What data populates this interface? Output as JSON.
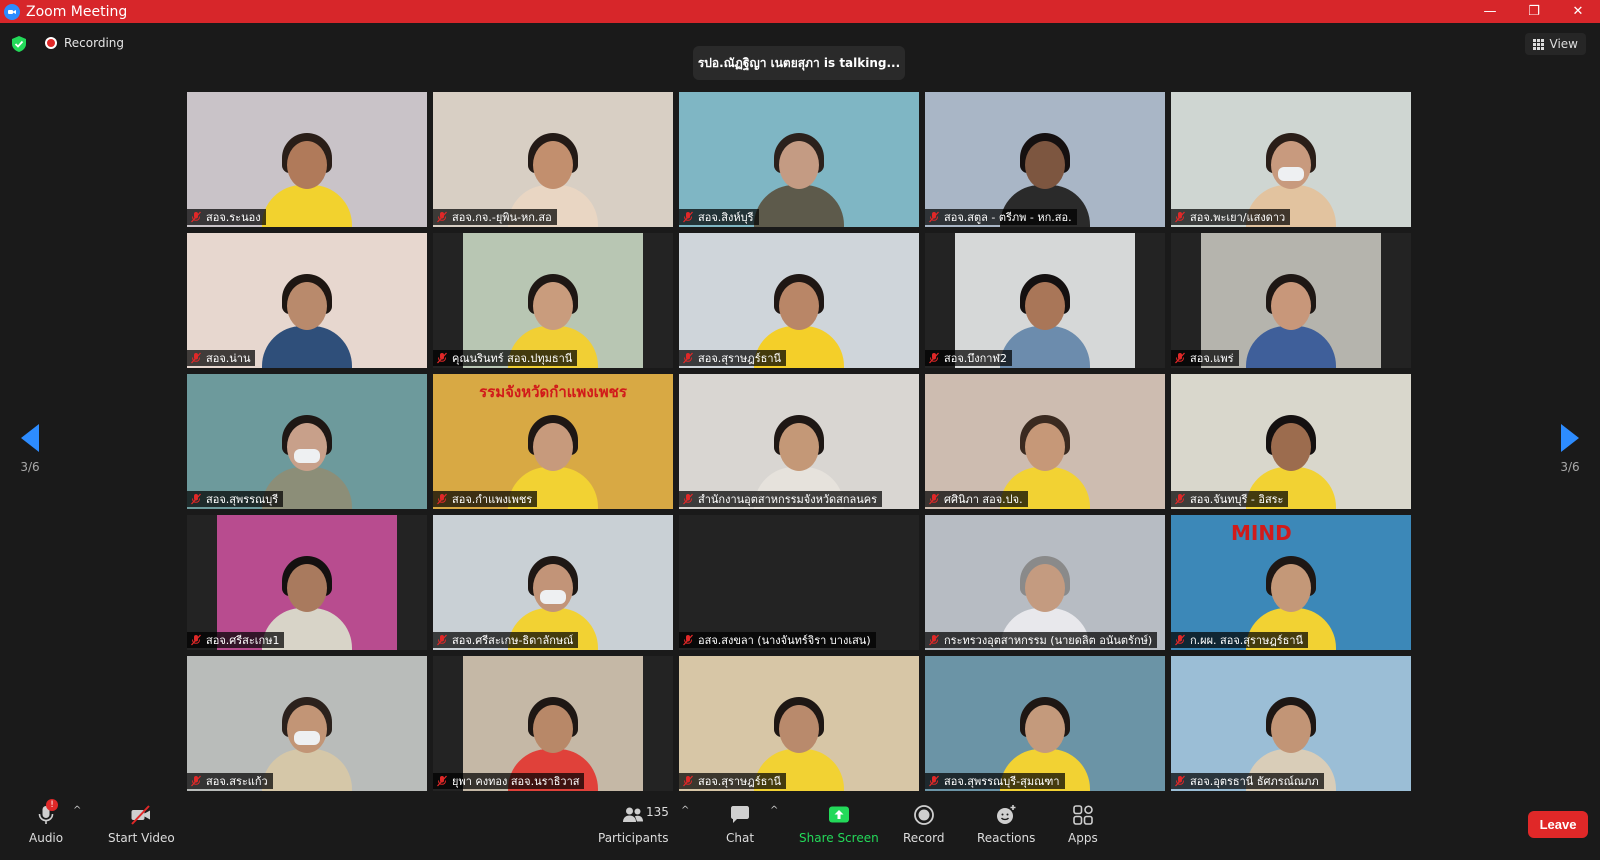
{
  "window": {
    "title": "Zoom Meeting",
    "minimize": "—",
    "maximize": "❐",
    "close": "✕"
  },
  "topbar": {
    "recording_label": "Recording",
    "talking": "รปอ.ณัฏฐิญา เนตยสุภา is talking...",
    "view_label": "View"
  },
  "pagination": {
    "left": "3/6",
    "right": "3/6"
  },
  "tiles": [
    {
      "name": "สอจ.ระนอง",
      "bg": "#c9c3c8",
      "fill": "full",
      "skin": "#b07a5a",
      "shirt": "#f2d22e",
      "hair": "#2a1e18",
      "mask": false
    },
    {
      "name": "สอจ.กจ.-ยุพิน-หก.สอ",
      "bg": "#d8cfc4",
      "fill": "full",
      "skin": "#c28f6e",
      "shirt": "#e9d6c3",
      "hair": "#231a16",
      "mask": false
    },
    {
      "name": "สอจ.สิงห์บุรี",
      "bg": "#7fb6c4",
      "fill": "full",
      "skin": "#c49b83",
      "shirt": "#5d5a4b",
      "hair": "#2b211c",
      "mask": false
    },
    {
      "name": "สอจ.สตูล - ตรีภพ - หก.สอ.",
      "bg": "#a9b6c6",
      "fill": "full",
      "skin": "#7d5640",
      "shirt": "#2a2a2a",
      "hair": "#151010",
      "mask": false
    },
    {
      "name": "สอจ.พะเยา/แสงดาว",
      "bg": "#cfd6d2",
      "fill": "full",
      "skin": "#c89a7e",
      "shirt": "#e2c39f",
      "hair": "#2a1e18",
      "mask": true
    },
    {
      "name": "สอจ.น่าน",
      "bg": "#e7d7cf",
      "fill": "full",
      "skin": "#b98a6c",
      "shirt": "#2f4f7a",
      "hair": "#1e1612",
      "mask": false
    },
    {
      "name": "คุณนรินทร์ สอจ.ปทุมธานี",
      "bg": "#b8c6b3",
      "fill": "narrow",
      "skin": "#c99c7d",
      "shirt": "#f1cf34",
      "hair": "#1e1714",
      "mask": false
    },
    {
      "name": "สอจ.สุราษฎร์ธานี",
      "bg": "#cfd5da",
      "fill": "full",
      "skin": "#b98667",
      "shirt": "#f4cf29",
      "hair": "#1f1714",
      "mask": false
    },
    {
      "name": "สอจ.บึงกาฬ2",
      "bg": "#d6d8d8",
      "fill": "narrow",
      "skin": "#a97658",
      "shirt": "#6c8cad",
      "hair": "#141010",
      "mask": false
    },
    {
      "name": "สอจ.แพร่",
      "bg": "#b5b4ad",
      "fill": "narrow",
      "skin": "#c8977a",
      "shirt": "#3f5f9a",
      "hair": "#1e1714",
      "mask": false
    },
    {
      "name": "สอจ.สุพรรณบุรี",
      "bg": "#6d9a9c",
      "fill": "full",
      "skin": "#c8a08a",
      "shirt": "#8c8e78",
      "hair": "#1e1714",
      "mask": true
    },
    {
      "name": "สอจ.กำแพงเพชร",
      "bg": "#d8a944",
      "fill": "full",
      "skin": "#c79a7c",
      "shirt": "#f2d233",
      "hair": "#1e1714",
      "mask": false,
      "banner": "รรมจังหวัดกำแพงเพชร"
    },
    {
      "name": "สำนักงานอุตสาหกรรมจังหวัดสกลนคร",
      "bg": "#d9d6d2",
      "fill": "full",
      "skin": "#c49877",
      "shirt": "#e6e2dc",
      "hair": "#1e1714",
      "mask": false
    },
    {
      "name": "ศศินิภา สอจ.ปจ.",
      "bg": "#cdbcb0",
      "fill": "full",
      "skin": "#c69878",
      "shirt": "#f2d233",
      "hair": "#3a2a20",
      "mask": false
    },
    {
      "name": "สอจ.จันทบุรี - อิสระ",
      "bg": "#d9d7cc",
      "fill": "full",
      "skin": "#9c6c4e",
      "shirt": "#f2d233",
      "hair": "#141010",
      "mask": false
    },
    {
      "name": "สอจ.ศรีสะเกษ1",
      "bg": "#b84c8f",
      "fill": "narrow",
      "skin": "#a97a5e",
      "shirt": "#d8d4c8",
      "hair": "#141010",
      "mask": false
    },
    {
      "name": "สอจ.ศรีสะเกษ-ธิดาลักษณ์",
      "bg": "#c9d0d5",
      "fill": "full",
      "skin": "#c29478",
      "shirt": "#f2d233",
      "hair": "#1e1714",
      "mask": true
    },
    {
      "name": "อสจ.สงขลา (นางจันทร์จิรา บางเสน)",
      "bg": "#232323",
      "fill": "none",
      "skin": "#000000",
      "shirt": "#000000",
      "hair": "#000000",
      "mask": false
    },
    {
      "name": "กระทรวงอุตสาหกรรม (นายดลิต อนันตรักษ์)",
      "bg": "#b7bcc3",
      "fill": "full",
      "skin": "#c49b80",
      "shirt": "#e8e8ec",
      "hair": "#8a8a8a",
      "mask": false
    },
    {
      "name": "ก.ผผ. สอจ.สุราษฎร์ธานี",
      "bg": "#3c88b8",
      "fill": "full",
      "skin": "#c49878",
      "shirt": "#f2d233",
      "hair": "#1e1714",
      "mask": false,
      "mind": "MIND"
    },
    {
      "name": "สอจ.สระแก้ว",
      "bg": "#b9bcba",
      "fill": "full",
      "skin": "#c29576",
      "shirt": "#d5c7a8",
      "hair": "#2b211c",
      "mask": true
    },
    {
      "name": "ยุพา  คงทอง สอจ.นราธิวาส",
      "bg": "#c5b8a6",
      "fill": "narrow",
      "skin": "#b88868",
      "shirt": "#e0413a",
      "hair": "#1e1714",
      "mask": false
    },
    {
      "name": "สอจ.สุราษฎร์ธานี",
      "bg": "#d7c6a6",
      "fill": "full",
      "skin": "#b98a6c",
      "shirt": "#f2d233",
      "hair": "#1e1714",
      "mask": false
    },
    {
      "name": "สอจ.สุพรรณบุรี-สุมณฑา",
      "bg": "#6b94a6",
      "fill": "full",
      "skin": "#c49a7c",
      "shirt": "#f2d233",
      "hair": "#1e1714",
      "mask": false
    },
    {
      "name": "สอจ.อุตรธานี ธัศภรณ์ณภภ",
      "bg": "#9bbed6",
      "fill": "full",
      "skin": "#c29576",
      "shirt": "#d9cdb8",
      "hair": "#1e1714",
      "mask": false
    }
  ],
  "toolbar": {
    "audio": "Audio",
    "audio_badge": "!",
    "video": "Start Video",
    "participants": "Participants",
    "participants_count": "135",
    "chat": "Chat",
    "share": "Share Screen",
    "record": "Record",
    "reactions": "Reactions",
    "apps": "Apps",
    "leave": "Leave",
    "caret": "^"
  },
  "colors": {
    "titlebar": "#d7262a",
    "accent": "#2d8cff",
    "share": "#23d959",
    "leave": "#e02828"
  }
}
